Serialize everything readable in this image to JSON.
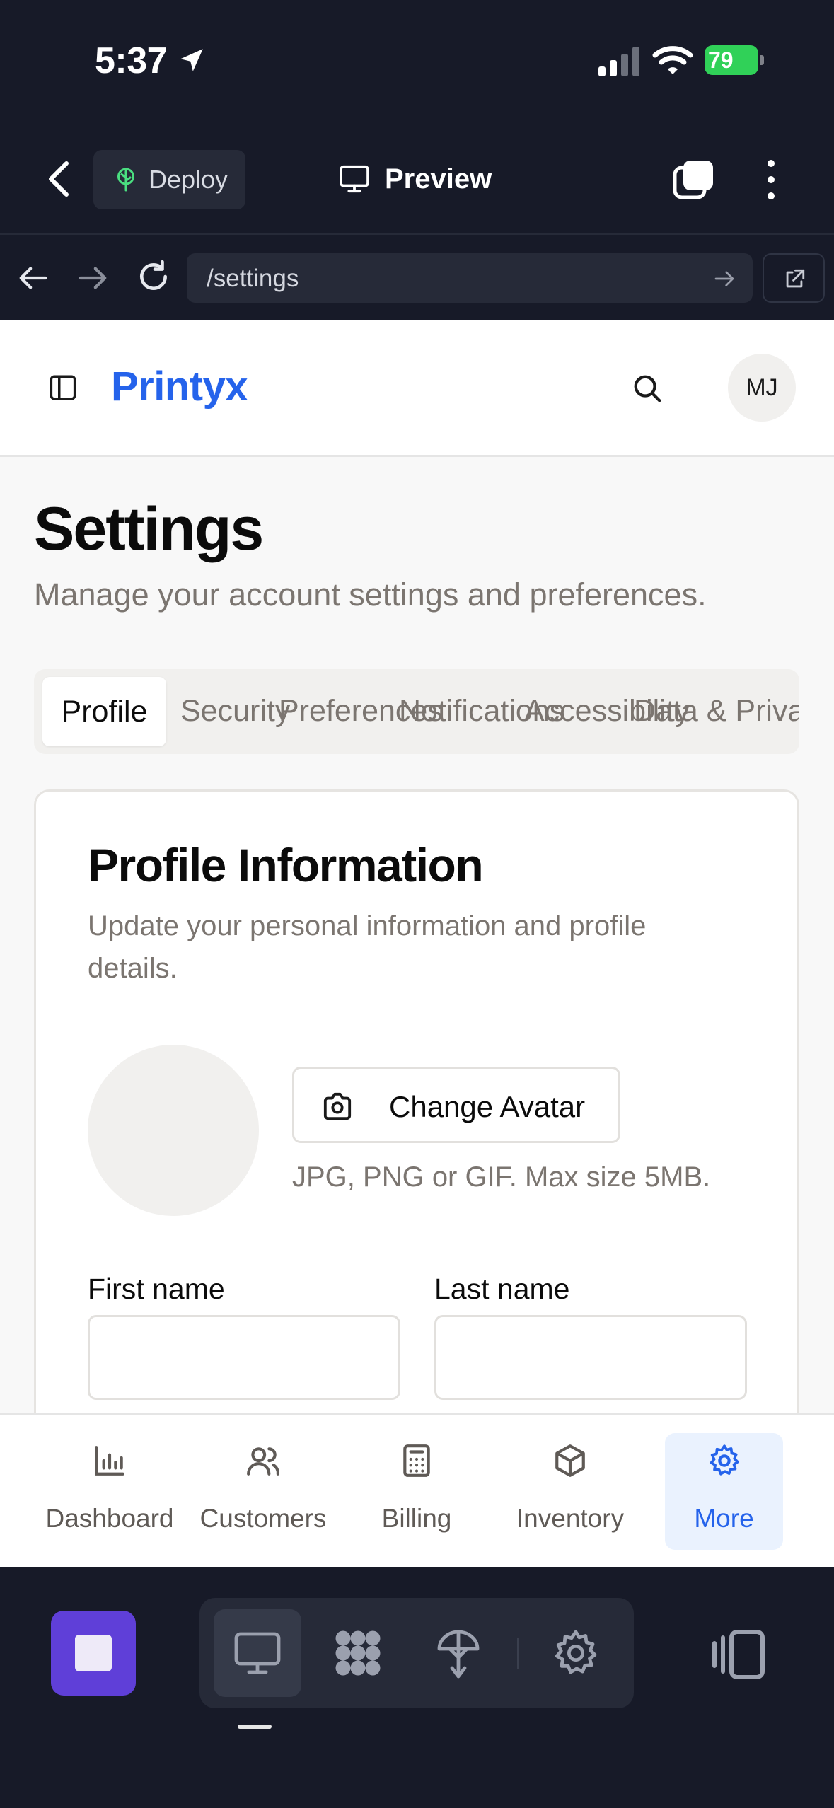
{
  "status_bar": {
    "time": "5:37",
    "battery": "79"
  },
  "toolbar": {
    "deploy_label": "Deploy",
    "preview_label": "Preview"
  },
  "browser": {
    "url": "/settings"
  },
  "header": {
    "brand": "Printyx",
    "avatar_initials": "MJ"
  },
  "page": {
    "title": "Settings",
    "subtitle": "Manage your account settings and preferences."
  },
  "tabs": [
    {
      "label": "Profile",
      "active": true
    },
    {
      "label": "Security"
    },
    {
      "label": "Preferences"
    },
    {
      "label": "Notifications"
    },
    {
      "label": "Accessibility"
    },
    {
      "label": "Data & Privacy"
    }
  ],
  "profile_card": {
    "title": "Profile Information",
    "description": "Update your personal information and profile details.",
    "change_avatar_label": "Change Avatar",
    "avatar_hint": "JPG, PNG or GIF. Max size 5MB.",
    "first_name_label": "First name",
    "last_name_label": "Last name",
    "first_name_value": "",
    "last_name_value": ""
  },
  "bottom_nav": [
    {
      "label": "Dashboard",
      "icon": "bar-chart-icon"
    },
    {
      "label": "Customers",
      "icon": "users-icon"
    },
    {
      "label": "Billing",
      "icon": "calculator-icon"
    },
    {
      "label": "Inventory",
      "icon": "box-icon"
    },
    {
      "label": "More",
      "icon": "gear-icon",
      "active": true
    }
  ],
  "colors": {
    "brand": "#2563eb",
    "dark_bg": "#171a28",
    "stop_button": "#5f3fd8",
    "active_nav_bg": "#eaf2fe",
    "battery": "#30d158"
  }
}
